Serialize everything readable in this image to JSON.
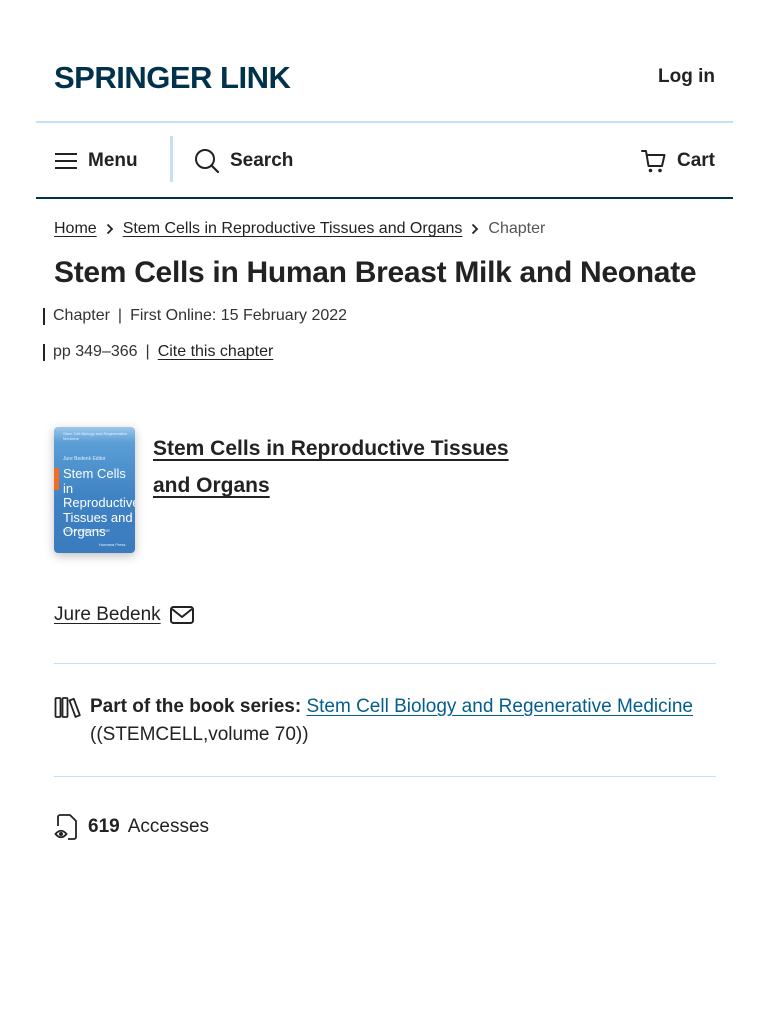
{
  "header": {
    "logo": "SPRINGER LINK",
    "login": "Log in"
  },
  "nav": {
    "menu": "Menu",
    "search": "Search",
    "cart": "Cart"
  },
  "breadcrumb": {
    "home": "Home",
    "book": "Stem Cells in Reproductive Tissues and Organs",
    "current": "Chapter"
  },
  "article": {
    "title": "Stem Cells in Human Breast Milk and Neonate",
    "type": "Chapter",
    "first_online": "First Online: 15 February 2022",
    "pages": "pp 349–366",
    "cite": "Cite this chapter"
  },
  "book": {
    "title_line1": "Stem Cells in Reproductive Tissues",
    "title_line2": "and Organs",
    "cover": {
      "top_text": "Stem Cell Biology and Regenerative Medicine",
      "editor": "Jure Bedenk Editor",
      "title": "Stem Cells in Reproductive Tissues and Organs",
      "subtitle": "From Fertility to Cancer",
      "publisher": "Humana Press"
    }
  },
  "author": {
    "name": "Jure Bedenk"
  },
  "series": {
    "label": "Part of the book series:",
    "name": "Stem Cell Biology and Regenerative Medicine",
    "volume": "((STEMCELL,volume 70))"
  },
  "metrics": {
    "accesses_count": "619",
    "accesses_label": "Accesses"
  },
  "colors": {
    "brand": "#01324b",
    "link": "#025e8d",
    "divider": "#c5e0f4",
    "cover_accent": "#f26d21"
  }
}
